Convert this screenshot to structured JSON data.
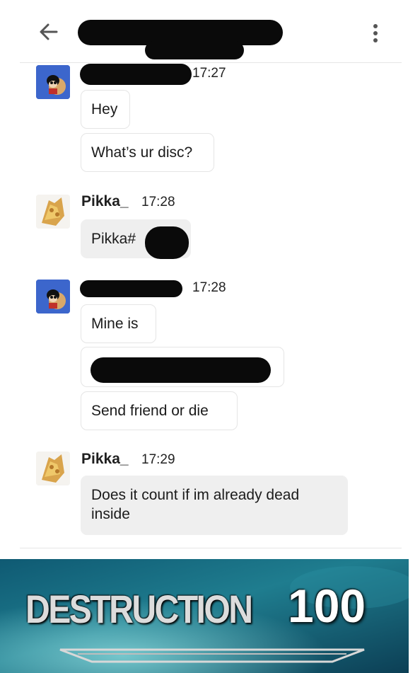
{
  "header": {
    "back_icon": "arrow-left-icon",
    "menu_icon": "more-vertical-icon"
  },
  "messages": [
    {
      "username": "",
      "time": "17:27",
      "bubbles": [
        "Hey",
        "What’s ur disc?"
      ]
    },
    {
      "username": "Pikka_",
      "time": "17:28",
      "bubbles": [
        "Pikka#"
      ]
    },
    {
      "username": "",
      "time": "17:28",
      "bubbles": [
        "Mine is",
        "",
        "Send friend or die"
      ]
    },
    {
      "username": "Pikka_",
      "time": "17:29",
      "bubbles": [
        "Does it count if im already dead inside"
      ]
    }
  ],
  "meme": {
    "word": "DESTRUCTION",
    "number": "100"
  },
  "colors": {
    "bubble_self": "#efefef",
    "bubble_other": "#ffffff",
    "bubble_border": "#e5e5e5",
    "redaction": "#0a0a0a"
  }
}
